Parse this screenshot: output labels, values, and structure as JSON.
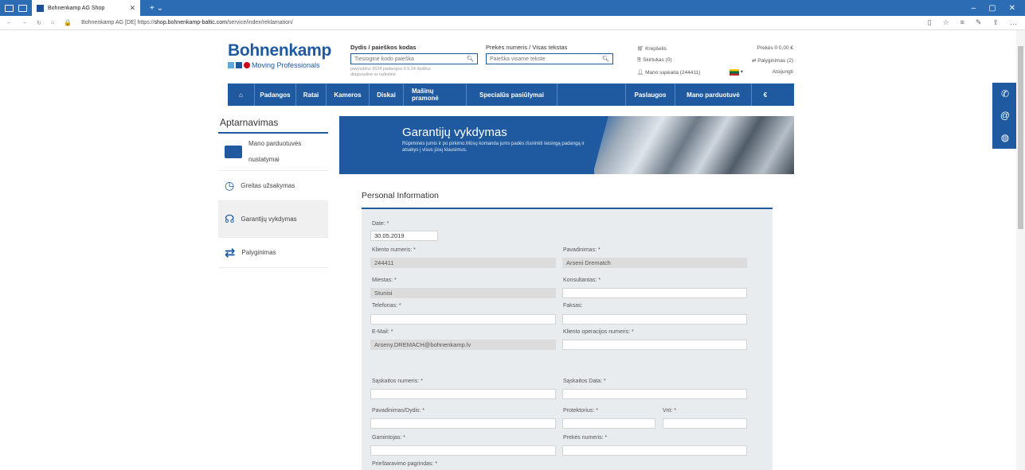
{
  "browser": {
    "tab_title": "Bohnenkamp AG Shop",
    "lock_text": "Bohnenkamp AG [DE]",
    "url_prefix": "https://",
    "url_domain": "shop.bohnenkamp-baltic.com",
    "url_path": "/service/index/reklamation/"
  },
  "logo": {
    "brand": "Bohnenkamp",
    "tagline": "Moving Professionals",
    "colors": [
      "#5fa8d9",
      "#1f5aa0",
      "#d0021b"
    ]
  },
  "search": {
    "size_label": "Dydis / paieškos kodas",
    "size_placeholder": "Tiesioginė kodo paieška",
    "size_hint": "pavyzdžiui 9524 padangos 9.5.24 dydžiui diagonalinė ar radialinė",
    "text_label": "Prekės numeris / Visas tekstas",
    "text_placeholder": "Paieška visame tekste"
  },
  "cart": {
    "cart_label": "Krepšelis",
    "cart_value": "Prekės 0  0,00 €",
    "notes": "Skirtukas (0)",
    "compare": "Palyginimas (2)",
    "account": "Mano sąskaita (244411)",
    "logout": "Atsijungti"
  },
  "nav": {
    "items": [
      "Padangos",
      "Ratai",
      "Kameros",
      "Diskai",
      "Mašinų pramonė",
      "Specialūs pasiūlymai",
      "Paslaugos",
      "Mano parduotuvė",
      "€"
    ]
  },
  "sidebar": {
    "title": "Aptarnavimas",
    "items": [
      "Mano parduotuvės nustatymai",
      "Greitas užsakymas",
      "Garantijų vykdymas",
      "Palyginimas"
    ]
  },
  "banner": {
    "title": "Garantijų vykdymas",
    "text": "Rūpiminės jumis ir po pirkimo.Mūsų komanda jums padės išsirinkti teisingą padangą ir atsakys į visus jūsų klausimus."
  },
  "form": {
    "heading": "Personal Information",
    "date_label": "Date: *",
    "date_value": "30.05.2019",
    "customer_no_label": "Kliento numeris: *",
    "customer_no_value": "244411",
    "name_label": "Pavadinimas: *",
    "name_value": "Arseni Drematch",
    "city_label": "Miestas: *",
    "city_value": "Stunisi",
    "consultant_label": "Konsultantas: *",
    "phone_label": "Telefonas: *",
    "fax_label": "Faksas:",
    "email_label": "E-Mail: *",
    "email_value": "Arseny.DREMACH@bohnenkamp.lv",
    "op_label": "Kliento operacijos numeris: *",
    "invoice_no_label": "Sąskaitos numeris: *",
    "invoice_date_label": "Sąskaitos Data: *",
    "size_label": "Pavadinimas/Dydis: *",
    "tread_label": "Protektorius: *",
    "qty_label": "Vnt: *",
    "maker_label": "Gamintojas: *",
    "item_no_label": "Prekės numeris: *",
    "reason_label": "Prieštaravimo pagrindas: *"
  },
  "icons": [
    "phone-icon",
    "at-icon",
    "globe-icon"
  ]
}
